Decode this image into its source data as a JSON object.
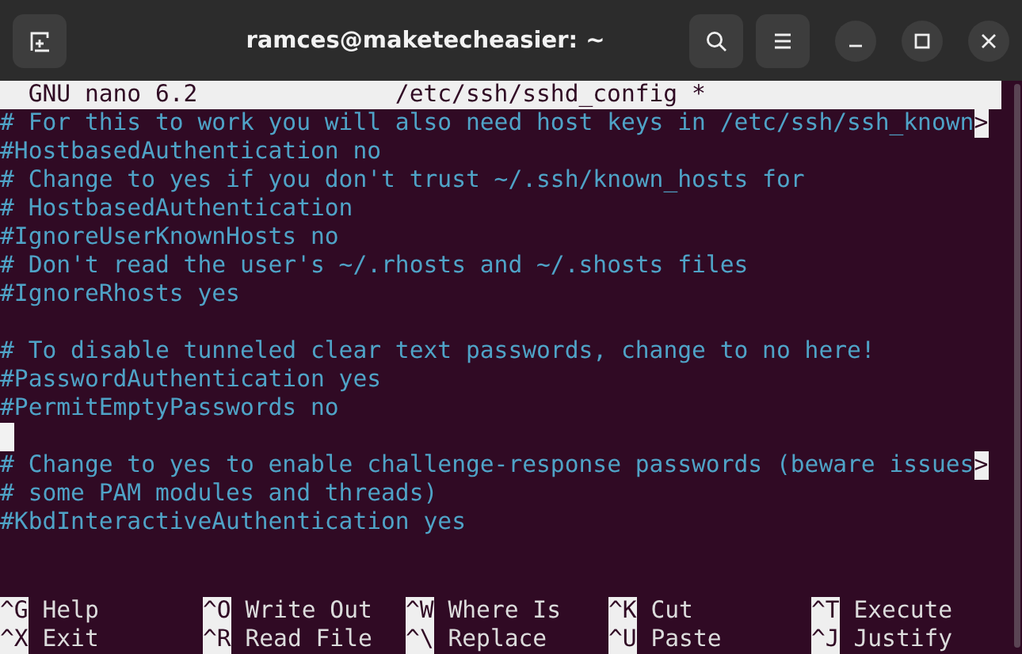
{
  "window": {
    "title": "ramces@maketecheasier: ~"
  },
  "header": {
    "program": "GNU nano 6.2",
    "filename": "/etc/ssh/sshd_config *"
  },
  "lines": [
    {
      "kind": "text",
      "text": "# For this to work you will also need host keys in /etc/ssh/ssh_known",
      "marker": ">"
    },
    {
      "kind": "text",
      "text": "#HostbasedAuthentication no"
    },
    {
      "kind": "text",
      "text": "# Change to yes if you don't trust ~/.ssh/known_hosts for"
    },
    {
      "kind": "text",
      "text": "# HostbasedAuthentication"
    },
    {
      "kind": "text",
      "text": "#IgnoreUserKnownHosts no"
    },
    {
      "kind": "text",
      "text": "# Don't read the user's ~/.rhosts and ~/.shosts files"
    },
    {
      "kind": "text",
      "text": "#IgnoreRhosts yes"
    },
    {
      "kind": "blank"
    },
    {
      "kind": "text",
      "text": "# To disable tunneled clear text passwords, change to no here!"
    },
    {
      "kind": "text",
      "text": "#PasswordAuthentication yes"
    },
    {
      "kind": "text",
      "text": "#PermitEmptyPasswords no"
    },
    {
      "kind": "cursor"
    },
    {
      "kind": "text",
      "text": "# Change to yes to enable challenge-response passwords (beware issues",
      "marker": ">"
    },
    {
      "kind": "text",
      "text": "# some PAM modules and threads)"
    },
    {
      "kind": "text",
      "text": "#KbdInteractiveAuthentication yes"
    }
  ],
  "shortcuts": [
    {
      "key": "^G",
      "label": "Help"
    },
    {
      "key": "^O",
      "label": "Write Out"
    },
    {
      "key": "^W",
      "label": "Where Is"
    },
    {
      "key": "^K",
      "label": "Cut"
    },
    {
      "key": "^T",
      "label": "Execute"
    },
    {
      "key": "^X",
      "label": "Exit"
    },
    {
      "key": "^R",
      "label": "Read File"
    },
    {
      "key": "^\\",
      "label": "Replace"
    },
    {
      "key": "^U",
      "label": "Paste"
    },
    {
      "key": "^J",
      "label": "Justify"
    }
  ]
}
